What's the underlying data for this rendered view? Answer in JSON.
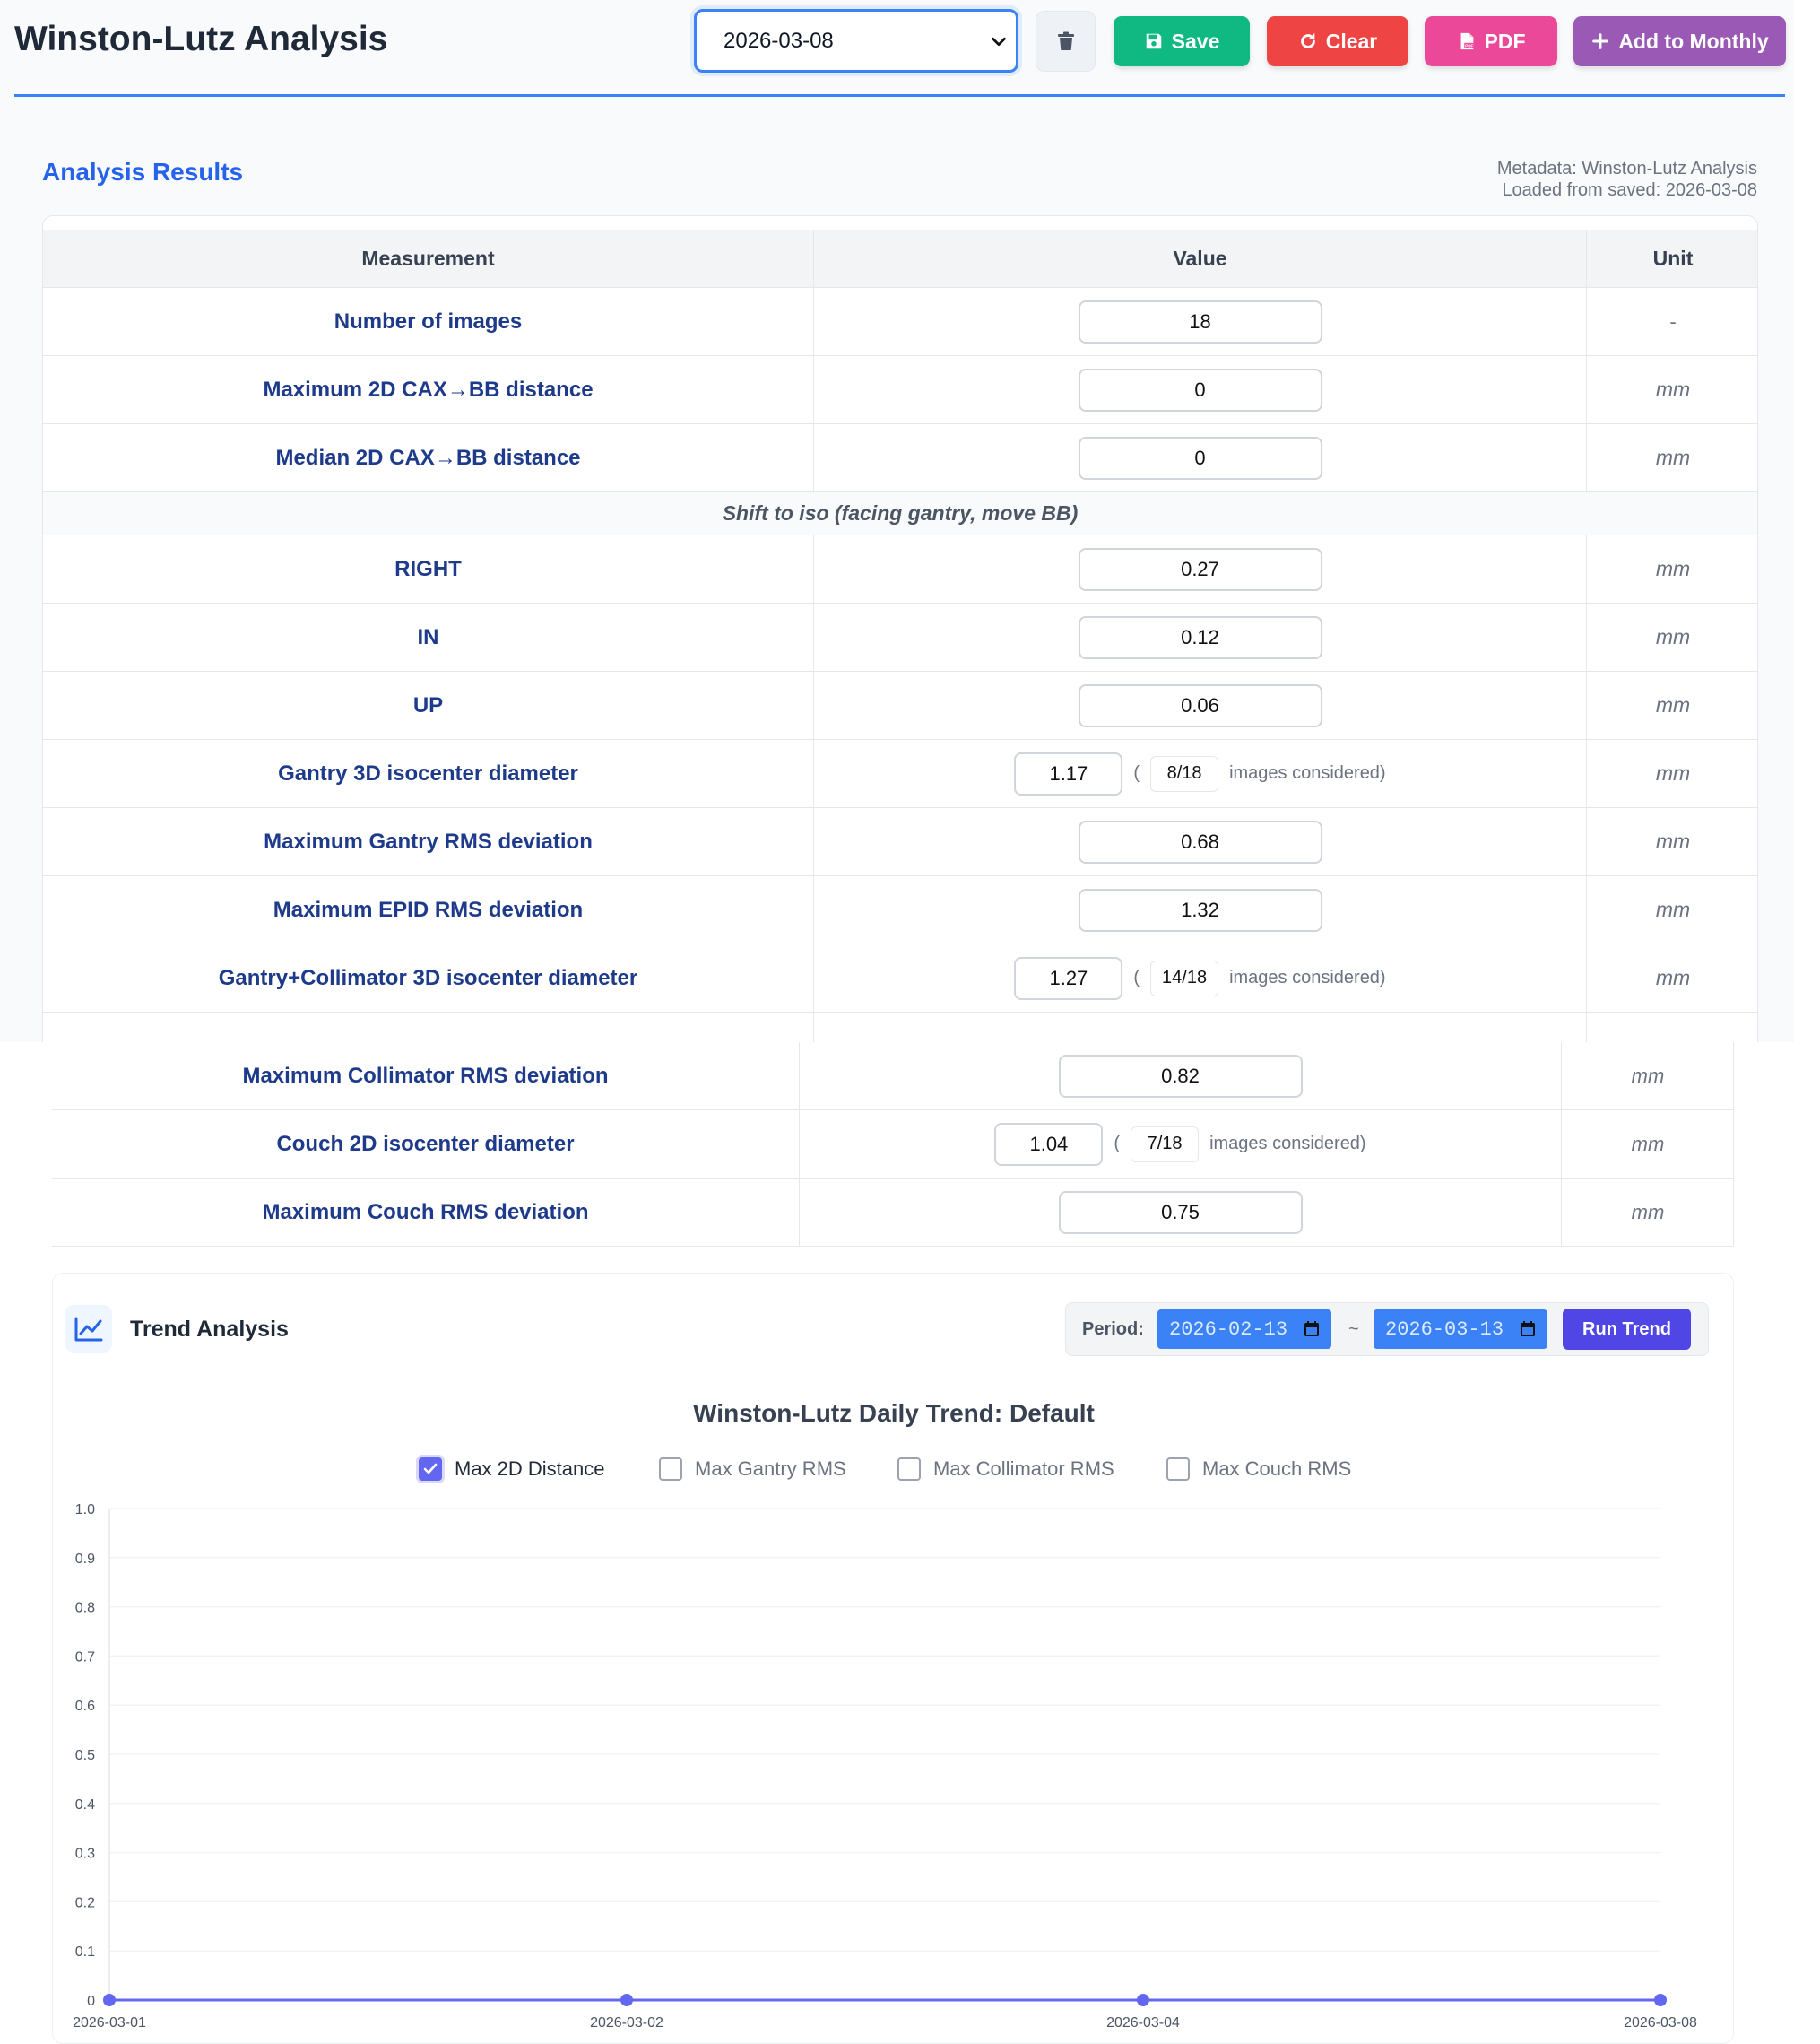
{
  "header": {
    "title": "Winston-Lutz Analysis",
    "selected_date": "2026-03-08",
    "buttons": {
      "save": "Save",
      "clear": "Clear",
      "pdf": "PDF",
      "add_monthly": "Add to Monthly"
    }
  },
  "results": {
    "title": "Analysis Results",
    "metadata_line": "Metadata: Winston-Lutz Analysis",
    "loaded_line": "Loaded from saved: 2026-03-08",
    "columns": [
      "Measurement",
      "Value",
      "Unit"
    ],
    "section_label": "Shift to iso (facing gantry, move BB)",
    "images_considered_suffix": "images considered)",
    "open_paren": "(",
    "rows": [
      {
        "label": "Number of images",
        "value": "18",
        "unit": "-"
      },
      {
        "label": "Maximum 2D CAX→BB distance",
        "value": "0",
        "unit": "mm"
      },
      {
        "label": "Median 2D CAX→BB distance",
        "value": "0",
        "unit": "mm"
      },
      {
        "label": "RIGHT",
        "value": "0.27",
        "unit": "mm"
      },
      {
        "label": "IN",
        "value": "0.12",
        "unit": "mm"
      },
      {
        "label": "UP",
        "value": "0.06",
        "unit": "mm"
      },
      {
        "label": "Gantry 3D isocenter diameter",
        "value": "1.17",
        "count": "8/18",
        "unit": "mm"
      },
      {
        "label": "Maximum Gantry RMS deviation",
        "value": "0.68",
        "unit": "mm"
      },
      {
        "label": "Maximum EPID RMS deviation",
        "value": "1.32",
        "unit": "mm"
      },
      {
        "label": "Gantry+Collimator 3D isocenter diameter",
        "value": "1.27",
        "count": "14/18",
        "unit": "mm"
      },
      {
        "label": "Maximum Collimator RMS deviation",
        "value": "0.82",
        "unit": "mm"
      },
      {
        "label": "Couch 2D isocenter diameter",
        "value": "1.04",
        "count": "7/18",
        "unit": "mm"
      },
      {
        "label": "Maximum Couch RMS deviation",
        "value": "0.75",
        "unit": "mm"
      }
    ]
  },
  "trend": {
    "title": "Trend Analysis",
    "period_label": "Period:",
    "date_from": "2026-02-13",
    "date_to": "2026-03-13",
    "separator": "~",
    "run_button": "Run Trend"
  },
  "icons": {
    "select": "chevron-down-icon",
    "delete": "trash-icon",
    "save": "floppy-disk-icon",
    "clear": "rotate-icon",
    "pdf": "pdf-file-icon",
    "add": "plus-icon",
    "trend": "line-chart-icon",
    "date": "calendar-icon",
    "legend_check": "check-icon"
  },
  "colors": {
    "accent": "#3b82f6",
    "save": "#10b981",
    "clear": "#ef4444",
    "pdf": "#ec4899",
    "monthly": "#9b59b6",
    "run": "#4f46e5",
    "series": "#6366f1",
    "label": "#1e3a8a"
  },
  "chart_data": {
    "type": "line",
    "title": "Winston-Lutz Daily Trend: Default",
    "categories": [
      "2026-03-01",
      "2026-03-02",
      "2026-03-04",
      "2026-03-08"
    ],
    "series": [
      {
        "name": "Max 2D Distance",
        "values": [
          0,
          0,
          0,
          0
        ],
        "checked": true
      },
      {
        "name": "Max Gantry RMS",
        "values": [],
        "checked": false
      },
      {
        "name": "Max Collimator RMS",
        "values": [],
        "checked": false
      },
      {
        "name": "Max Couch RMS",
        "values": [],
        "checked": false
      }
    ],
    "ylim": [
      0,
      1.0
    ],
    "yticks": [
      "0",
      "0.1",
      "0.2",
      "0.3",
      "0.4",
      "0.5",
      "0.6",
      "0.7",
      "0.8",
      "0.9",
      "1.0"
    ],
    "grid": true,
    "legend_position": "top"
  }
}
